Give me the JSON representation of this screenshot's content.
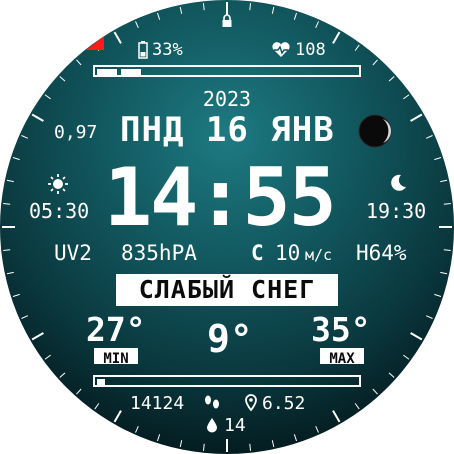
{
  "status": {
    "lock_icon": "lock-icon",
    "battery_icon": "battery-icon",
    "battery": "33%",
    "heart_icon": "heart-icon",
    "heart_rate": "108",
    "battery_fraction": 0.33
  },
  "date": {
    "year": "2023",
    "text": "ПНД 16 ЯНВ",
    "moon_icon": "moon-phase-icon"
  },
  "left_small": "0,97",
  "time": {
    "main": "14:55"
  },
  "sun": {
    "sunrise_icon": "sun-icon",
    "sunrise": "05:30",
    "sunset_icon": "crescent-moon-icon",
    "sunset": "19:30"
  },
  "weather": {
    "uv": "UV2",
    "pressure": "835hPA",
    "wind_dir": "С",
    "wind_speed": "10",
    "wind_unit": "м/с",
    "humidity": "H64%",
    "condition": "СЛАБЫЙ СНЕГ",
    "temp_min": "27°",
    "temp_now": "9°",
    "temp_max": "35°",
    "min_label": "MIN",
    "max_label": "MAX"
  },
  "activity": {
    "steps": "14124",
    "steps_icon": "footprints-icon",
    "distance_icon": "location-pin-icon",
    "distance": "6.52",
    "drop_icon": "water-drop-icon",
    "water": "14",
    "steps_fraction": 0.03
  },
  "colors": {
    "accent_red": "#ff1a1a",
    "background": "#11555c"
  }
}
